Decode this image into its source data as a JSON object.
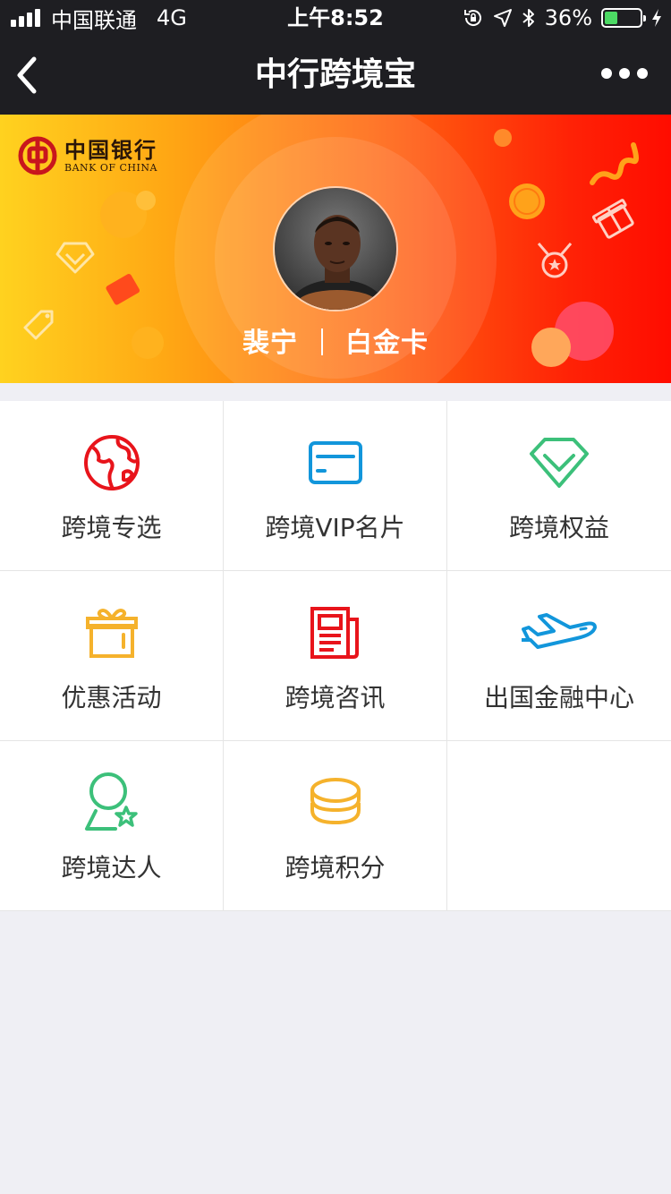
{
  "status_bar": {
    "carrier": "中国联通",
    "network": "4G",
    "time": "上午8:52",
    "battery": "36%",
    "battery_level": 0.36
  },
  "nav": {
    "title": "中行跨境宝",
    "back_icon": "chevron-left-icon",
    "more_icon": "more-dots-icon"
  },
  "banner": {
    "bank_name_cn": "中国银行",
    "bank_name_en": "BANK OF CHINA",
    "member_name": "裴宁",
    "card_level": "白金卡"
  },
  "menu": [
    {
      "label": "跨境专选",
      "icon": "globe-icon",
      "color": "#e8141b"
    },
    {
      "label": "跨境VIP名片",
      "icon": "card-icon",
      "color": "#1296db"
    },
    {
      "label": "跨境权益",
      "icon": "diamond-icon",
      "color": "#3cc07a"
    },
    {
      "label": "优惠活动",
      "icon": "gift-icon",
      "color": "#f5b22c"
    },
    {
      "label": "跨境咨讯",
      "icon": "newspaper-icon",
      "color": "#e8141b"
    },
    {
      "label": "出国金融中心",
      "icon": "airplane-icon",
      "color": "#1296db"
    },
    {
      "label": "跨境达人",
      "icon": "expert-user-icon",
      "color": "#3cc07a"
    },
    {
      "label": "跨境积分",
      "icon": "coins-icon",
      "color": "#f5b22c"
    }
  ],
  "colors": {
    "bar_bg": "#1e1e22",
    "page_bg": "#efeff4",
    "battery_fill": "#4cd964"
  }
}
